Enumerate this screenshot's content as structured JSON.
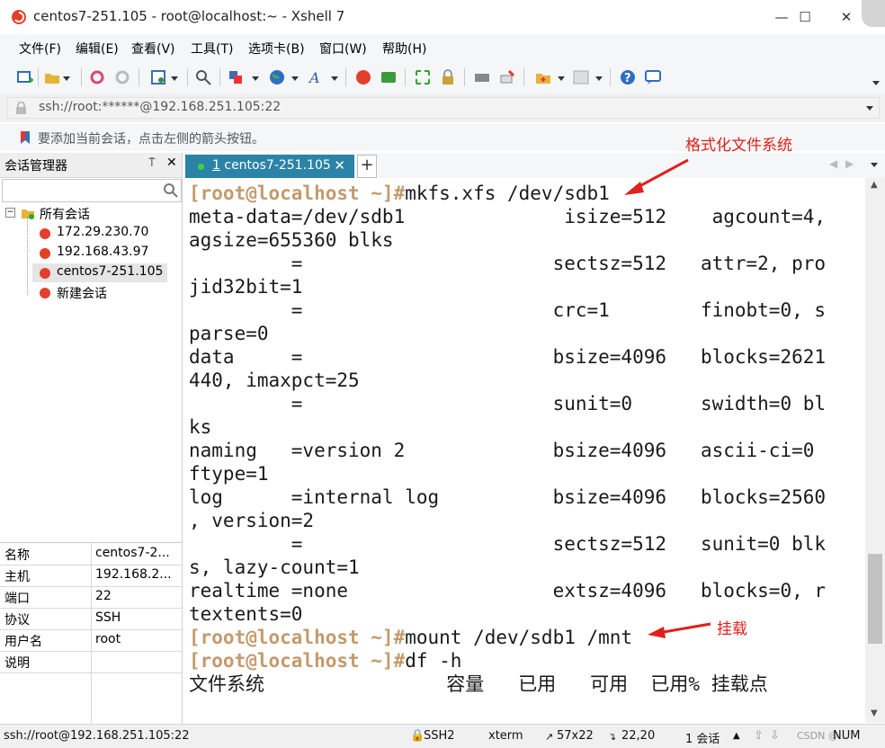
{
  "window": {
    "title": "centos7-251.105 - root@localhost:~ - Xshell 7",
    "accent_color": "#2b83a8"
  },
  "menu": [
    "文件(F)",
    "编辑(E)",
    "查看(V)",
    "工具(T)",
    "选项卡(B)",
    "窗口(W)",
    "帮助(H)"
  ],
  "address": {
    "value": "ssh://root:******@192.168.251.105:22"
  },
  "hint": {
    "text": "要添加当前会话，点击左侧的箭头按钮。"
  },
  "sidebar": {
    "title": "会话管理器",
    "root": "所有会话",
    "sessions": [
      "172.29.230.70",
      "192.168.43.97",
      "centos7-251.105",
      "新建会话"
    ],
    "props": [
      {
        "key": "名称",
        "value": "centos7-2..."
      },
      {
        "key": "主机",
        "value": "192.168.2..."
      },
      {
        "key": "端口",
        "value": "22"
      },
      {
        "key": "协议",
        "value": "SSH"
      },
      {
        "key": "用户名",
        "value": "root"
      },
      {
        "key": "说明",
        "value": ""
      }
    ]
  },
  "tab": {
    "number": "1",
    "label": "centos7-251.105"
  },
  "terminal": {
    "prompt": "[root@localhost ~]#",
    "lines": [
      {
        "prompt": true,
        "text": "mkfs.xfs /dev/sdb1"
      },
      {
        "prompt": false,
        "text": "meta-data=/dev/sdb1              isize=512    agcount=4,"
      },
      {
        "prompt": false,
        "text": "agsize=655360 blks"
      },
      {
        "prompt": false,
        "text": "         =                      sectsz=512   attr=2, pro"
      },
      {
        "prompt": false,
        "text": "jid32bit=1"
      },
      {
        "prompt": false,
        "text": "         =                      crc=1        finobt=0, s"
      },
      {
        "prompt": false,
        "text": "parse=0"
      },
      {
        "prompt": false,
        "text": "data     =                      bsize=4096   blocks=2621"
      },
      {
        "prompt": false,
        "text": "440, imaxpct=25"
      },
      {
        "prompt": false,
        "text": "         =                      sunit=0      swidth=0 bl"
      },
      {
        "prompt": false,
        "text": "ks"
      },
      {
        "prompt": false,
        "text": "naming   =version 2             bsize=4096   ascii-ci=0"
      },
      {
        "prompt": false,
        "text": "ftype=1"
      },
      {
        "prompt": false,
        "text": "log      =internal log          bsize=4096   blocks=2560"
      },
      {
        "prompt": false,
        "text": ", version=2"
      },
      {
        "prompt": false,
        "text": "         =                      sectsz=512   sunit=0 blk"
      },
      {
        "prompt": false,
        "text": "s, lazy-count=1"
      },
      {
        "prompt": false,
        "text": "realtime =none                  extsz=4096   blocks=0, r"
      },
      {
        "prompt": false,
        "text": "textents=0"
      },
      {
        "prompt": true,
        "text": "mount /dev/sdb1 /mnt"
      },
      {
        "prompt": true,
        "text": "df -h"
      },
      {
        "prompt": false,
        "text": "文件系统                容量   已用   可用  已用% 挂载点"
      }
    ]
  },
  "annotations": {
    "format": "格式化文件系统",
    "mount": "挂载"
  },
  "status": {
    "address": "ssh://root@192.168.251.105:22",
    "protocol": "SSH2",
    "term": "xterm",
    "size": "57x22",
    "cursor": "22,20",
    "sessions": "1 会话",
    "num": "NUM",
    "watermark": "CSDN @..."
  }
}
